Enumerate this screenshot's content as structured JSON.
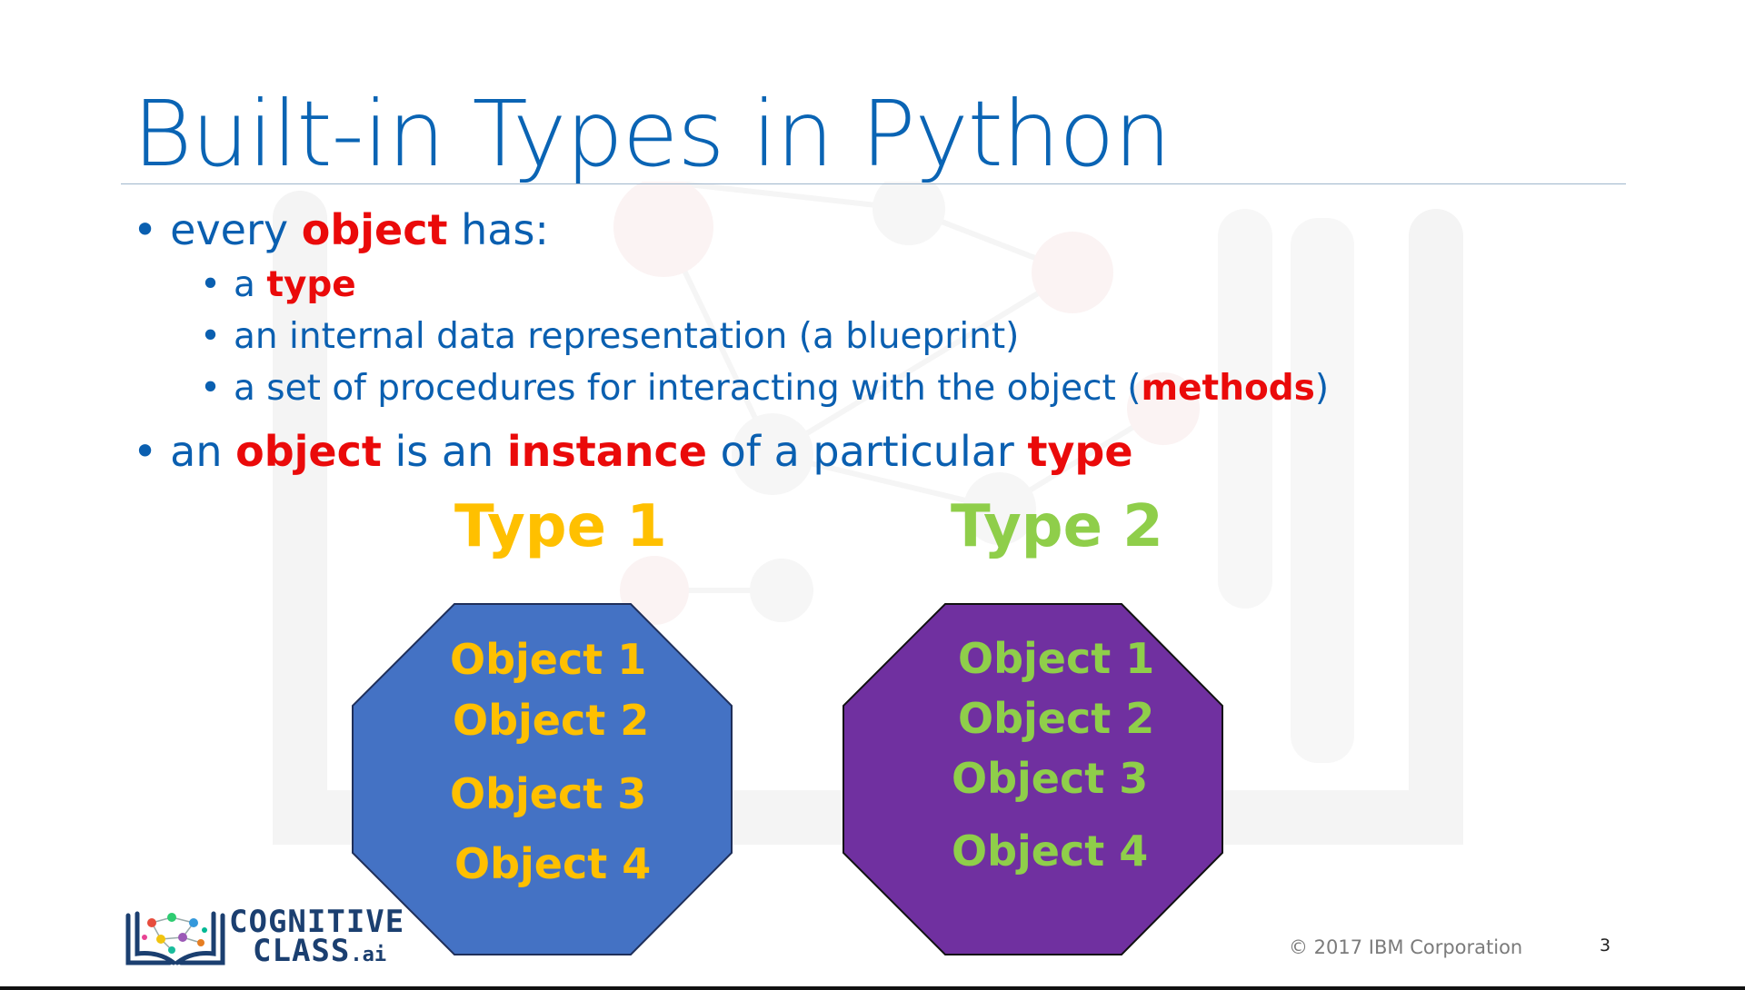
{
  "title": "Built-in Types in Python",
  "bullets": {
    "b1": {
      "pre": "every ",
      "em": "object",
      "post": " has:"
    },
    "sub1": {
      "pre": "a ",
      "em": "type"
    },
    "sub2": {
      "text": "an internal data representation (a blueprint)"
    },
    "sub3": {
      "pre": "a set of procedures for interacting with the object (",
      "em": "methods",
      "post": ")"
    },
    "b2": {
      "pre": "an ",
      "em1": "object",
      "mid1": " is an ",
      "em2": "instance",
      "mid2": " of a particular ",
      "em3": "type"
    }
  },
  "bullet_glyph": "•",
  "type1": {
    "label": "Type 1",
    "objects": [
      "Object 1",
      "Object 2",
      "Object 3",
      "Object 4"
    ]
  },
  "type2": {
    "label": "Type 2",
    "objects": [
      "Object 1",
      "Object 2",
      "Object 3",
      "Object 4"
    ]
  },
  "colors": {
    "title": "#0a64b4",
    "text": "#0a5fb0",
    "emphasis": "#ea0a0a",
    "type1": "#ffc000",
    "type2": "#8fce4a",
    "octagon1": "#4472c4",
    "octagon2": "#7030a0"
  },
  "footer": {
    "copyright": "© 2017 IBM Corporation",
    "page_number": "3"
  },
  "logo": {
    "line1": "COGNITIVE",
    "line2": "CLASS",
    "suffix": ".ai"
  }
}
